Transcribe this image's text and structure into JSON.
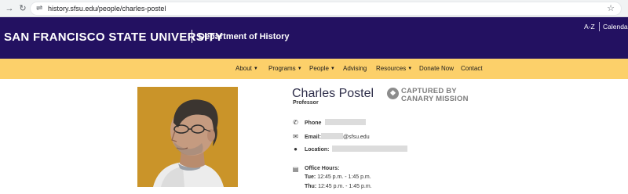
{
  "browser": {
    "url": "history.sfsu.edu/people/charles-postel",
    "back_icon": "arrow-back-icon",
    "reload_icon": "reload-icon",
    "site_info_icon": "site-info-icon",
    "bookmark_icon": "star-icon"
  },
  "header": {
    "university": "SAN FRANCISCO STATE UNIVERSITY",
    "separator": "|",
    "department": "Department of History",
    "utility_links": [
      "A-Z",
      "Calendar"
    ]
  },
  "nav": {
    "items": [
      {
        "label": "About",
        "has_dropdown": true
      },
      {
        "label": "Programs",
        "has_dropdown": true
      },
      {
        "label": "People",
        "has_dropdown": true
      },
      {
        "label": "Advising",
        "has_dropdown": false
      },
      {
        "label": "Resources",
        "has_dropdown": true
      },
      {
        "label": "Donate Now",
        "has_dropdown": false
      },
      {
        "label": "Contact",
        "has_dropdown": false
      }
    ]
  },
  "profile": {
    "name": "Charles Postel",
    "title": "Professor",
    "badge": {
      "line1": "CAPTURED BY",
      "line2": "CANARY MISSION"
    },
    "phone_label": "Phone",
    "email_label": "Email:",
    "email_domain": "@sfsu.edu",
    "location_label": "Location:",
    "office_hours_label": "Office Hours:",
    "office_hours": [
      {
        "day": "Tue:",
        "time": "12:45 p.m. - 1:45 p.m."
      },
      {
        "day": "Thu:",
        "time": "12:45 p.m. - 1:45 p.m."
      }
    ]
  },
  "colors": {
    "header_purple": "#231161",
    "nav_gold": "#fcd06a",
    "browser_bar": "#f1f3f4"
  }
}
